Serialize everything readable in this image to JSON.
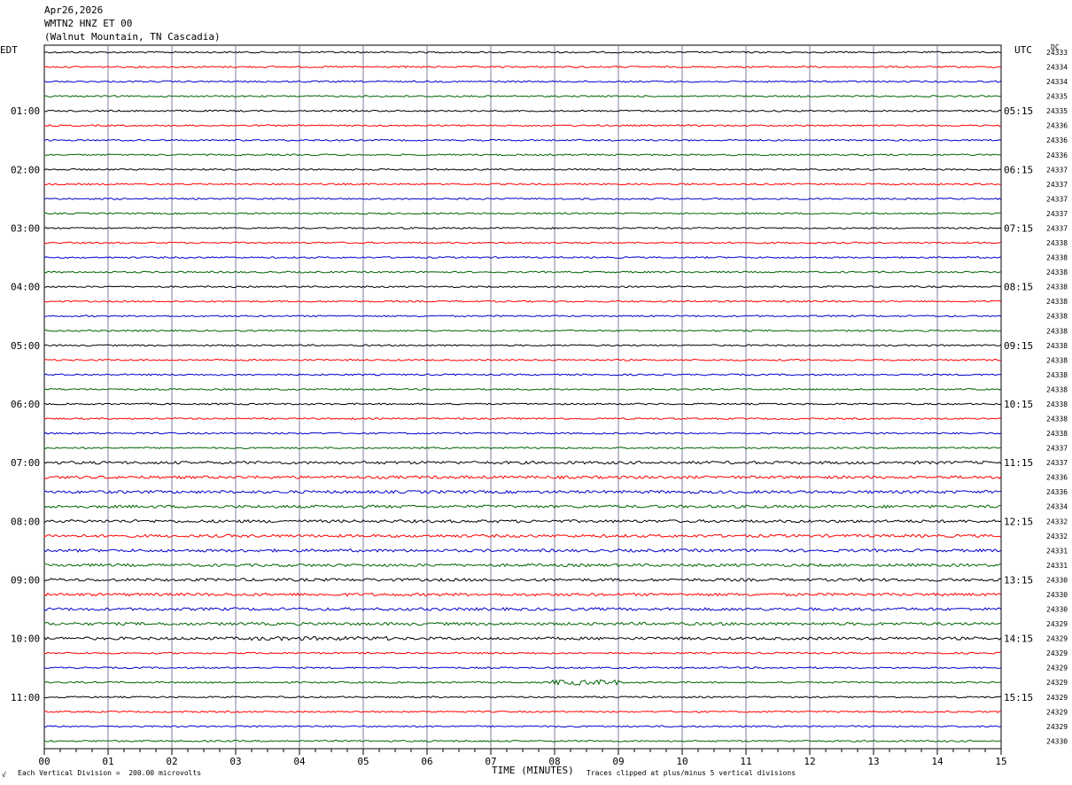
{
  "header": {
    "date": "Apr26,2026",
    "station": "WMTN2 HNZ ET 00",
    "location": "(Walnut Mountain, TN Cascadia)"
  },
  "left_axis_label": "EDT",
  "right_axis_label": "UTC",
  "dc_label": "DC",
  "footer": {
    "scale_note": "Each Vertical Division =  200.00 microvolts",
    "xlabel": "TIME (MINUTES)",
    "clip_note": "Traces clipped at plus/minus 5 vertical divisions",
    "corner_mark": "√"
  },
  "colors": {
    "trace_cycle": [
      "#000000",
      "#ff0000",
      "#0000cc",
      "#006400"
    ],
    "gridline": "#7f7f9f",
    "frame": "#000000"
  },
  "chart_data": {
    "type": "line",
    "title": "WMTN2 HNZ ET 00",
    "xlabel": "TIME (MINUTES)",
    "xlim": [
      0,
      15
    ],
    "x_ticks": [
      "00",
      "01",
      "02",
      "03",
      "04",
      "05",
      "06",
      "07",
      "08",
      "09",
      "10",
      "11",
      "12",
      "13",
      "14",
      "15"
    ],
    "trace_interval_minutes": 15,
    "trace_count": 48,
    "hour_labels_edt": [
      "01:00",
      "02:00",
      "03:00",
      "04:00",
      "05:00",
      "06:00",
      "07:00",
      "08:00",
      "09:00",
      "10:00",
      "11:00"
    ],
    "hour_labels_utc": [
      "05:15",
      "06:15",
      "07:15",
      "08:15",
      "09:15",
      "10:15",
      "11:15",
      "12:15",
      "13:15",
      "14:15",
      "15:15"
    ],
    "dc_values": [
      "24333",
      "24334",
      "24334",
      "24335",
      "24335",
      "24336",
      "24336",
      "24336",
      "24337",
      "24337",
      "24337",
      "24337",
      "24337",
      "24338",
      "24338",
      "24338",
      "24338",
      "24338",
      "24338",
      "24338",
      "24338",
      "24338",
      "24338",
      "24338",
      "24338",
      "24338",
      "24338",
      "24337",
      "24337",
      "24336",
      "24336",
      "24334",
      "24332",
      "24332",
      "24331",
      "24331",
      "24330",
      "24330",
      "24330",
      "24329",
      "24329",
      "24329",
      "24329",
      "24329",
      "24329",
      "24329",
      "24329",
      "24330"
    ]
  }
}
